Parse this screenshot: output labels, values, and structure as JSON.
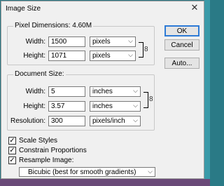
{
  "window": {
    "title": "Image Size",
    "close_glyph": "✕"
  },
  "pixel_dimensions": {
    "legend": "Pixel Dimensions:  4.60M",
    "width_label": "Width:",
    "width_value": "1500",
    "width_unit": "pixels",
    "height_label": "Height:",
    "height_value": "1071",
    "height_unit": "pixels"
  },
  "document_size": {
    "legend": "Document Size:",
    "width_label": "Width:",
    "width_value": "5",
    "width_unit": "inches",
    "height_label": "Height:",
    "height_value": "3.57",
    "height_unit": "inches",
    "resolution_label": "Resolution:",
    "resolution_value": "300",
    "resolution_unit": "pixels/inch"
  },
  "options": {
    "scale_styles": {
      "label": "Scale Styles",
      "checked": true
    },
    "constrain_proportions": {
      "label": "Constrain Proportions",
      "checked": true
    },
    "resample_image": {
      "label": "Resample Image:",
      "checked": true
    },
    "resample_method": "Bicubic (best for smooth gradients)"
  },
  "buttons": {
    "ok": "OK",
    "cancel": "Cancel",
    "auto": "Auto..."
  },
  "glyphs": {
    "chevron": "⌵",
    "check": "✓",
    "chain": "8"
  }
}
